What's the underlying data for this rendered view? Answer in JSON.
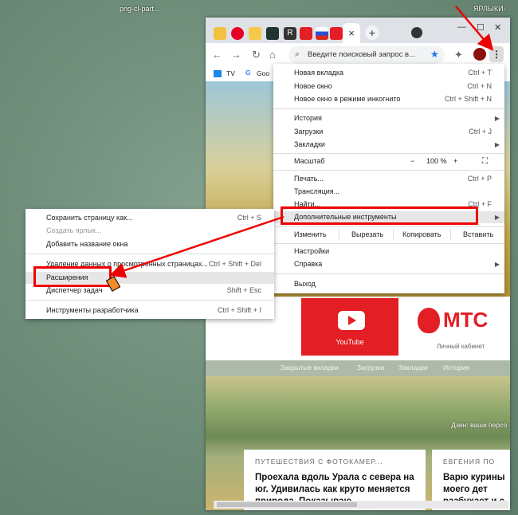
{
  "desktop": {
    "file_name": "png-cl-part...",
    "folder_name": "ЯРЛЫКИ-"
  },
  "browser": {
    "search_placeholder": "Введите поисковый запрос в...",
    "bookmarks": {
      "tv": "TV",
      "google": "Goo"
    },
    "youtube_tile": "YouTube",
    "mts_tile_logo": "МТС",
    "mts_tile_caption": "Личный кабинет",
    "page_tabs": [
      "Закрытые вкладки",
      "Загрузки",
      "Закладки",
      "История"
    ],
    "zen_label": "Дзен: ваши персо",
    "card1": {
      "source": "ПУТЕШЕСТВИЯ С ФОТОКАМЕР...",
      "title": "Проехала вдоль Урала с севера на юг. Удивилась как круто меняется природа. Показываю"
    },
    "card2": {
      "source": "ЕВГЕНИЯ ПО",
      "title": "Варю курины моего дет разбухает и с"
    }
  },
  "main_menu": {
    "new_tab": {
      "label": "Новая вкладка",
      "shortcut": "Ctrl + T"
    },
    "new_window": {
      "label": "Новое окно",
      "shortcut": "Ctrl + N"
    },
    "incognito": {
      "label": "Новое окно в режиме инкогнито",
      "shortcut": "Ctrl + Shift + N"
    },
    "history": {
      "label": "История"
    },
    "downloads": {
      "label": "Загрузки",
      "shortcut": "Ctrl + J"
    },
    "bookmarks": {
      "label": "Закладки"
    },
    "zoom": {
      "label": "Масштаб",
      "minus": "−",
      "value": "100 %",
      "plus": "+"
    },
    "print": {
      "label": "Печать...",
      "shortcut": "Ctrl + P"
    },
    "cast": {
      "label": "Трансляция..."
    },
    "find": {
      "label": "Найти...",
      "shortcut": "Ctrl + F"
    },
    "more_tools": {
      "label": "Дополнительные инструменты"
    },
    "edit": {
      "label": "Изменить",
      "cut": "Вырезать",
      "copy": "Копировать",
      "paste": "Вставить"
    },
    "settings": {
      "label": "Настройки"
    },
    "help": {
      "label": "Справка"
    },
    "exit": {
      "label": "Выход"
    }
  },
  "submenu": {
    "save_page": {
      "label": "Сохранить страницу как...",
      "shortcut": "Ctrl + S"
    },
    "create_shortcut": {
      "label": "Создать ярлык..."
    },
    "name_window": {
      "label": "Добавить название окна"
    },
    "clear_data": {
      "label": "Удаление данных о просмотренных страницах...",
      "shortcut": "Ctrl + Shift + Del"
    },
    "extensions": {
      "label": "Расширения"
    },
    "task_manager": {
      "label": "Диспетчер задач",
      "shortcut": "Shift + Esc"
    },
    "dev_tools": {
      "label": "Инструменты разработчика",
      "shortcut": "Ctrl + Shift + I"
    }
  },
  "colors": {
    "highlight": "#e00000",
    "youtube_red": "#e31e24"
  }
}
